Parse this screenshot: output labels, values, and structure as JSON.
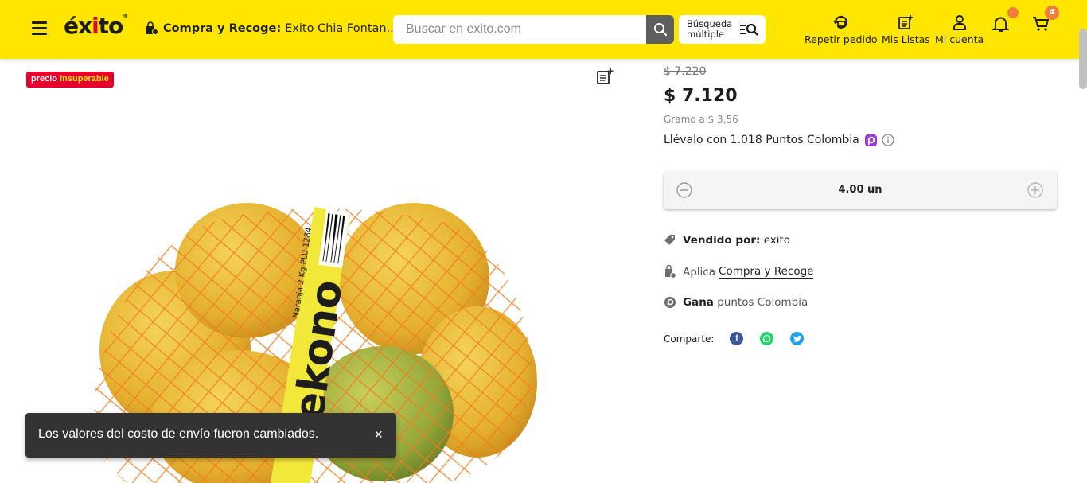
{
  "header": {
    "logo_text": "éxito",
    "store_prefix": "Compra y Recoge:",
    "store_name": "Exito Chia Fontan...",
    "search_placeholder": "Buscar en exito.com",
    "multi_search_line1": "Búsqueda",
    "multi_search_line2": "múltiple",
    "nav": [
      {
        "label": "Repetir pedido",
        "icon": "reorder-icon"
      },
      {
        "label": "Mis Listas",
        "icon": "list-icon"
      },
      {
        "label": "Mi cuenta",
        "icon": "user-icon"
      }
    ],
    "cart_count": "4",
    "brand_color": "#ffe600"
  },
  "product": {
    "badge_part1": "precio",
    "badge_part2": "insuperable",
    "old_price": "$ 7.220",
    "price": "$ 7.120",
    "unit_price": "Gramo a $ 3,56",
    "points_prefix": "Llévalo con",
    "points_value": "1.018",
    "points_suffix": "Puntos Colombia",
    "quantity": "4.00 un",
    "sold_by_label": "Vendido por:",
    "sold_by_value": "exito",
    "applies_label": "Aplica",
    "applies_link": "Compra y Recoge",
    "earn_label": "Gana",
    "earn_value": "puntos Colombia",
    "share_label": "Comparte:",
    "package_label": "ekono",
    "package_text": "Naranja 2 Kg   PLU 1284"
  },
  "toast": {
    "message": "Los valores del costo de envío fueron cambiados.",
    "close": "×"
  }
}
